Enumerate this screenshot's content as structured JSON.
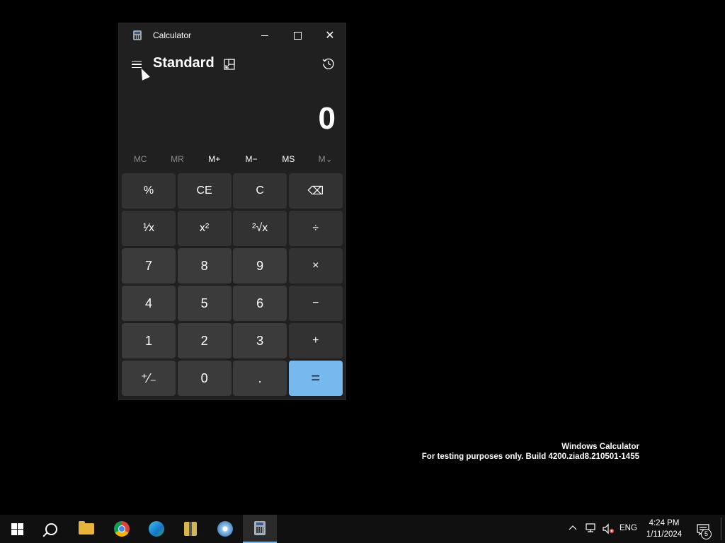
{
  "window": {
    "title": "Calculator",
    "minimize_icon": "minimize-icon",
    "maximize_icon": "maximize-icon",
    "close_icon": "close-icon"
  },
  "header": {
    "menu_icon": "hamburger-icon",
    "mode_title": "Standard",
    "keep_on_top_icon": "keep-on-top-icon",
    "history_icon": "history-icon"
  },
  "display": {
    "value": "0"
  },
  "memory": [
    {
      "label": "MC",
      "enabled": false
    },
    {
      "label": "MR",
      "enabled": false
    },
    {
      "label": "M+",
      "enabled": true
    },
    {
      "label": "M−",
      "enabled": true
    },
    {
      "label": "MS",
      "enabled": true
    },
    {
      "label": "M⌄",
      "enabled": false
    }
  ],
  "keys": {
    "percent": "%",
    "ce": "CE",
    "c": "C",
    "backspace": "⌫",
    "reciprocal": "¹⁄x",
    "square": "x²",
    "sqrt": "²√x",
    "divide": "÷",
    "seven": "7",
    "eight": "8",
    "nine": "9",
    "multiply": "×",
    "four": "4",
    "five": "5",
    "six": "6",
    "minus": "−",
    "one": "1",
    "two": "2",
    "three": "3",
    "plus": "+",
    "negate": "⁺⁄₋",
    "zero": "0",
    "decimal": ".",
    "equals": "="
  },
  "watermark": {
    "line1": "Windows Calculator",
    "line2": "For testing purposes only. Build 4200.ziad8.210501-1455"
  },
  "taskbar": {
    "items": [
      {
        "name": "start-icon"
      },
      {
        "name": "search-icon"
      },
      {
        "name": "file-explorer-icon"
      },
      {
        "name": "chrome-icon"
      },
      {
        "name": "edge-icon"
      },
      {
        "name": "archive-app-icon"
      },
      {
        "name": "disc-app-icon"
      },
      {
        "name": "calculator-icon",
        "active": true
      }
    ],
    "language": "ENG",
    "time": "4:24 PM",
    "date": "1/11/2024",
    "notification_count": "5"
  },
  "colors": {
    "accent": "#76b9ed",
    "window_bg": "#202020",
    "key_bg": "#323232",
    "digit_key_bg": "#3b3b3b"
  }
}
